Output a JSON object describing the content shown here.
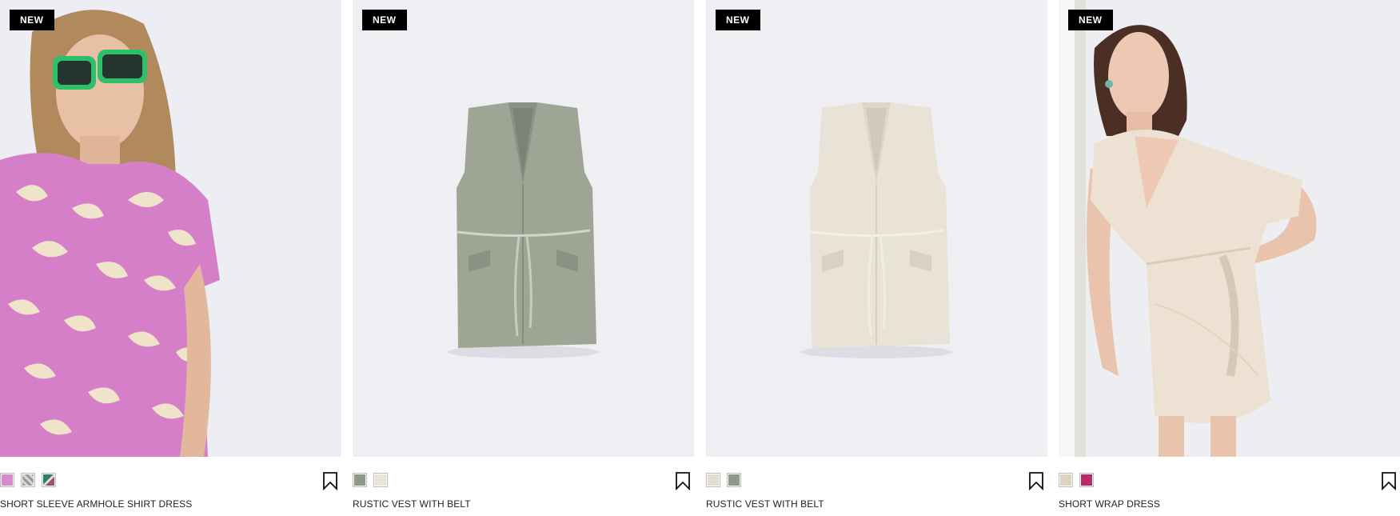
{
  "products": [
    {
      "badge": "NEW",
      "name": "SHORT SLEEVE ARMHOLE SHIRT DRESS",
      "image_icon": "pink-leaf-print-shirt-dress-model-photo",
      "swatches": [
        {
          "label": "pink leaf print",
          "color": "#d98acb"
        },
        {
          "label": "grey geometric print",
          "color": "#9a9a9a"
        },
        {
          "label": "green abstract print",
          "color": "#2f7f6b"
        }
      ]
    },
    {
      "badge": "NEW",
      "name": "RUSTIC VEST WITH BELT",
      "image_icon": "green-belted-vest-product-photo",
      "swatches": [
        {
          "label": "green",
          "color": "#8e9888"
        },
        {
          "label": "cream",
          "color": "#e8e4d8"
        }
      ]
    },
    {
      "badge": "NEW",
      "name": "RUSTIC VEST WITH BELT",
      "image_icon": "cream-belted-vest-product-photo",
      "swatches": [
        {
          "label": "cream",
          "color": "#e3ddd0"
        },
        {
          "label": "green",
          "color": "#8e9888"
        }
      ]
    },
    {
      "badge": "NEW",
      "name": "SHORT WRAP DRESS",
      "image_icon": "beige-wrap-dress-model-photo",
      "swatches": [
        {
          "label": "beige",
          "color": "#ddd3c3"
        },
        {
          "label": "magenta",
          "color": "#b82a63"
        }
      ]
    }
  ],
  "save_icon": "bookmark-icon"
}
